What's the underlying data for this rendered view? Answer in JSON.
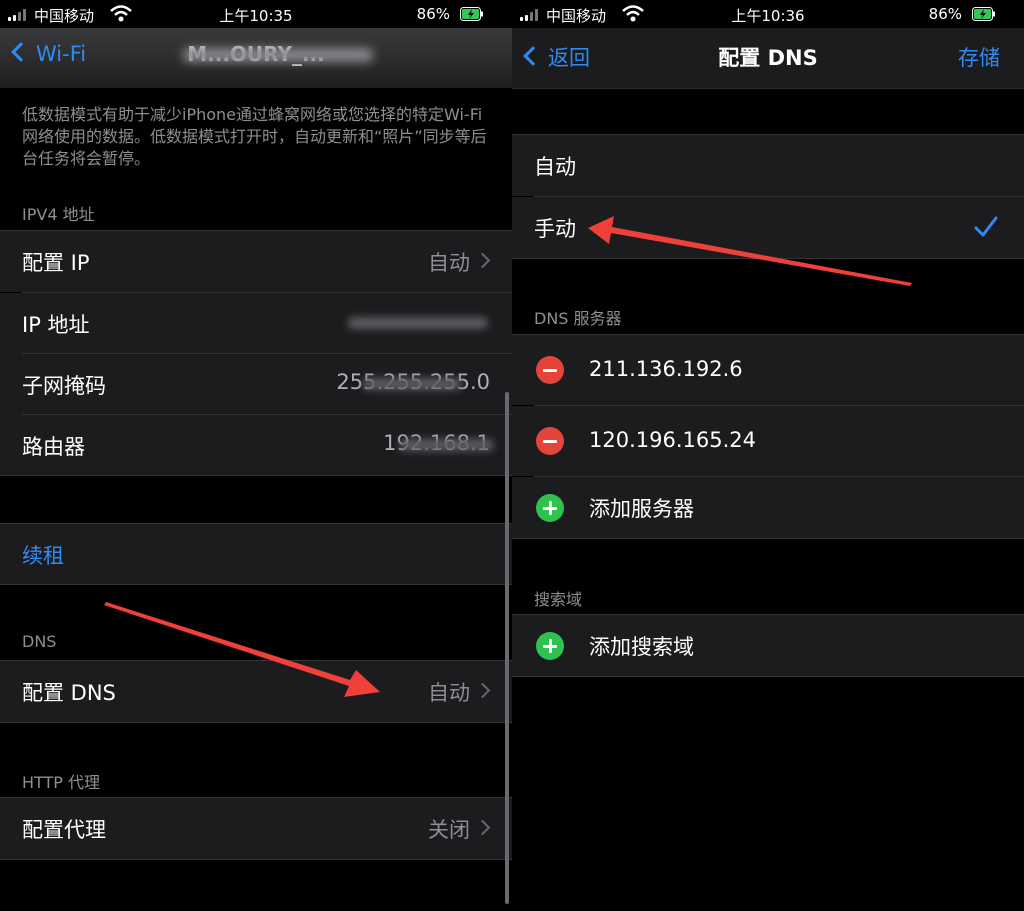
{
  "left": {
    "status": {
      "carrier": "中国移动",
      "time": "上午10:35",
      "battery": "86%"
    },
    "nav": {
      "back_label": "Wi-Fi",
      "title": "M...OURY_..."
    },
    "low_data_text": "低数据模式有助于减少iPhone通过蜂窝网络或您选择的特定Wi-Fi网络使用的数据。低数据模式打开时，自动更新和“照片”同步等后台任务将会暂停。",
    "ipv4": {
      "header": "IPV4 地址",
      "configure_ip": {
        "label": "配置 IP",
        "value": "自动"
      },
      "ip_address": {
        "label": "IP 地址"
      },
      "subnet_mask": {
        "label": "子网掩码",
        "value_visible": "255.255.255.0"
      },
      "router": {
        "label": "路由器",
        "value_visible": "192.168.1"
      }
    },
    "renew_lease": "续租",
    "dns": {
      "header": "DNS",
      "label": "配置 DNS",
      "value": "自动"
    },
    "http_proxy": {
      "header": "HTTP 代理",
      "label": "配置代理",
      "value": "关闭"
    }
  },
  "right": {
    "status": {
      "carrier": "中国移动",
      "time": "上午10:36",
      "battery": "86%"
    },
    "nav": {
      "back_label": "返回",
      "title": "配置 DNS",
      "save_label": "存储"
    },
    "mode": {
      "auto": "自动",
      "manual": "手动"
    },
    "dns_servers": {
      "header": "DNS 服务器",
      "servers": [
        "211.136.192.6",
        "120.196.165.24"
      ],
      "add_label": "添加服务器"
    },
    "search_domains": {
      "header": "搜索域",
      "add_label": "添加搜索域"
    }
  },
  "colors": {
    "accent": "#2f8bf4",
    "delete": "#e5443a",
    "add": "#2fc24f",
    "annotation_arrow": "#f0403a"
  }
}
